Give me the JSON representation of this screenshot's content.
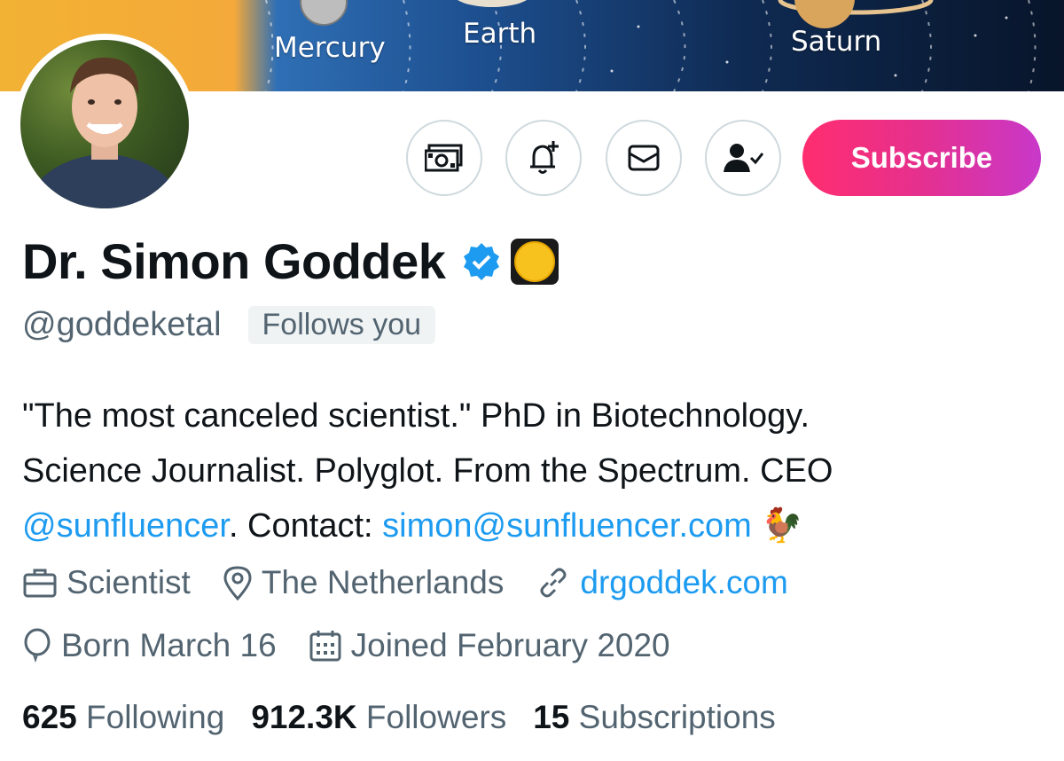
{
  "banner": {
    "planets": [
      "Mercury",
      "Earth",
      "Saturn"
    ]
  },
  "actions": {
    "tip_icon": "money-icon",
    "notify_icon": "bell-plus-icon",
    "message_icon": "envelope-icon",
    "following_icon": "person-check-icon",
    "subscribe_label": "Subscribe",
    "subscribe_gradient": [
      "#ff2d6f",
      "#c838c9"
    ]
  },
  "profile": {
    "name": "Dr. Simon Goddek",
    "handle": "@goddeketal",
    "follows_you": "Follows you",
    "bio_line1": "\"The most canceled scientist.\" PhD in Biotechnology.",
    "bio_line2": "Science Journalist. Polyglot. From the Spectrum. CEO",
    "bio_mention": "@sunfluencer",
    "bio_contact_label": ". Contact: ",
    "bio_email": "simon@sunfluencer.com",
    "bio_emoji": "🐓"
  },
  "meta": {
    "profession": "Scientist",
    "location": "The Netherlands",
    "website": "drgoddek.com",
    "birthday": "Born March 16",
    "joined": "Joined February 2020"
  },
  "stats": {
    "following_count": "625",
    "following_label": "Following",
    "followers_count": "912.3K",
    "followers_label": "Followers",
    "subscriptions_count": "15",
    "subscriptions_label": "Subscriptions"
  },
  "colors": {
    "accent": "#1d9bf0",
    "secondary_text": "#536471",
    "primary_text": "#0f1419"
  }
}
